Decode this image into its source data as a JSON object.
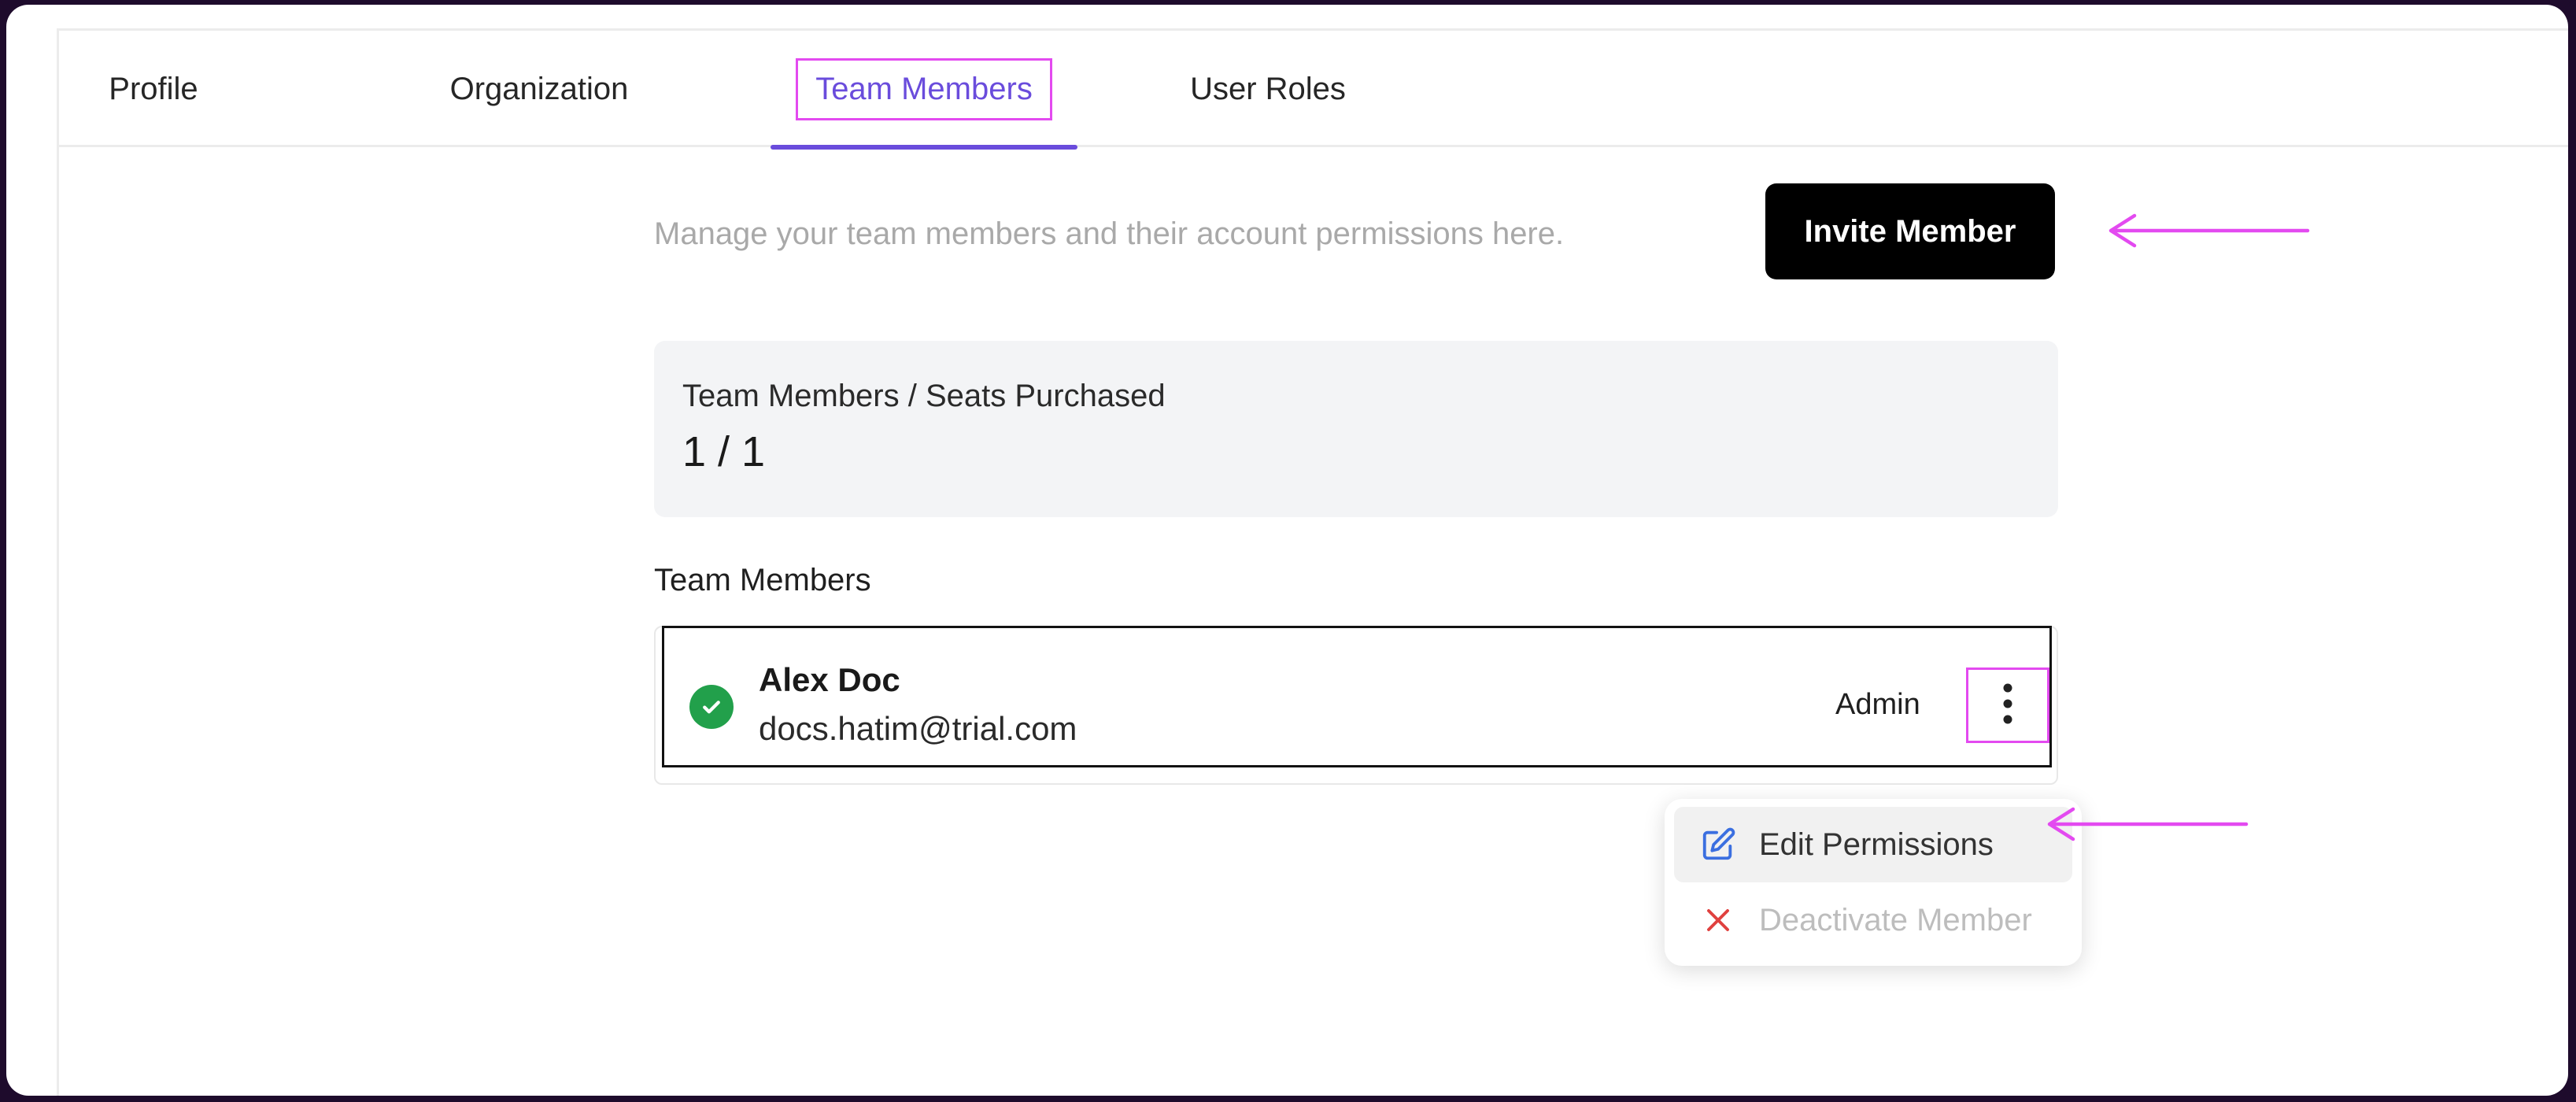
{
  "tabs": [
    {
      "label": "Profile"
    },
    {
      "label": "Organization"
    },
    {
      "label": "Team Members"
    },
    {
      "label": "User Roles"
    }
  ],
  "active_tab": "Team Members",
  "description": "Manage your team members and their account permissions here.",
  "invite_button": "Invite Member",
  "seats": {
    "label": "Team Members / Seats Purchased",
    "value": "1 / 1"
  },
  "members_section_title": "Team Members",
  "members": [
    {
      "name": "Alex Doc",
      "email": "docs.hatim@trial.com",
      "role": "Admin",
      "status": "active"
    }
  ],
  "member_menu": [
    {
      "label": "Edit Permissions",
      "icon": "edit-icon"
    },
    {
      "label": "Deactivate Member",
      "icon": "close-icon"
    }
  ],
  "colors": {
    "accent": "#6a4cdc",
    "highlight": "#e34af0",
    "success": "#22a04b",
    "danger": "#e0413f",
    "frame": "#1e0b2c"
  }
}
